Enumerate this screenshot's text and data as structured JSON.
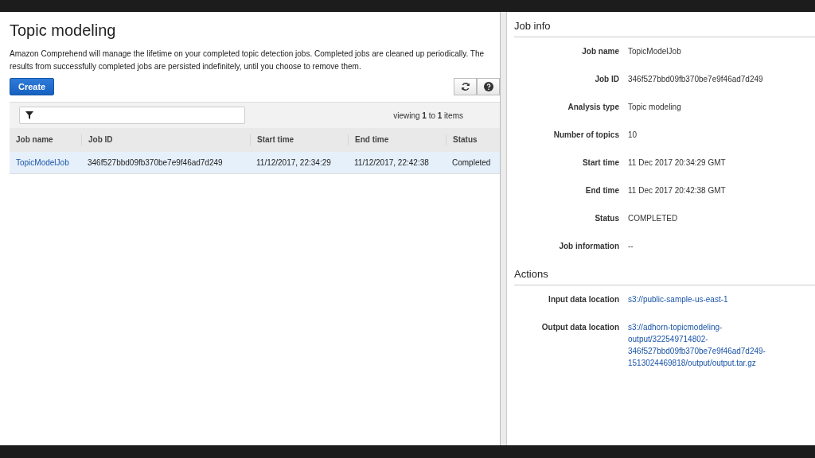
{
  "page": {
    "title": "Topic modeling",
    "description": "Amazon Comprehend will manage the lifetime on your completed topic detection jobs. Completed jobs are cleaned up periodically. The results from successfully completed jobs are persisted indefinitely, until you choose to remove them.",
    "create_button": "Create"
  },
  "table": {
    "viewing": "viewing **1** to **1** items",
    "columns": [
      "Job name",
      "Job ID",
      "Start time",
      "End time",
      "Status"
    ],
    "rows": [
      {
        "selected": true,
        "cells": [
          "TopicModelJob",
          "346f527bbd09fb370be7e9f46ad7d249",
          "11/12/2017, 22:34:29",
          "11/12/2017, 22:42:38",
          "Completed"
        ]
      }
    ]
  },
  "job_info": {
    "title": "Job info",
    "fields": [
      {
        "label": "Job name",
        "value": "TopicModelJob"
      },
      {
        "label": "Job ID",
        "value": "346f527bbd09fb370be7e9f46ad7d249"
      },
      {
        "label": "Analysis type",
        "value": "Topic modeling"
      },
      {
        "label": "Number of topics",
        "value": "10"
      },
      {
        "label": "Start time",
        "value": "11 Dec 2017 20:34:29 GMT"
      },
      {
        "label": "End time",
        "value": "11 Dec 2017 20:42:38 GMT"
      },
      {
        "label": "Status",
        "value": "COMPLETED"
      },
      {
        "label": "Job information",
        "value": "--"
      }
    ]
  },
  "actions": {
    "title": "Actions",
    "fields": [
      {
        "label": "Input data location",
        "value": "s3://public-sample-us-east-1"
      },
      {
        "label": "Output data location",
        "value": "s3://adhorn-topicmodeling-output/322549714802-346f527bbd09fb370be7e9f46ad7d249-1513024469818/output/output.tar.gz"
      }
    ]
  }
}
